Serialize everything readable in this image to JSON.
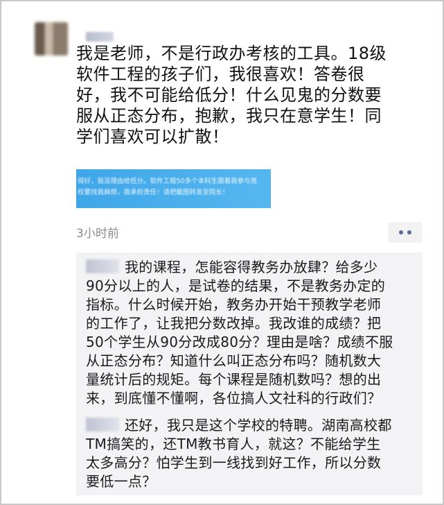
{
  "post": {
    "text_lines": [
      "我是老师，不是行政办考核的工具。18级",
      "软件工程的孩子们，我很喜欢！答卷很",
      "好，我不可能给低分！什么见鬼的分数要",
      "服从正态分布，抱歉，我只在意学生！同",
      "学们喜欢可以扩散！"
    ],
    "image_text_lines": [
      "得好，我没理由给低分。软件工程50多个本科生跟着我参与竞",
      "校要找我麻烦，我承担责任！请把截图转发至院长！"
    ],
    "time": "3小时前",
    "more_icon": "more-dots-icon"
  },
  "comments": [
    {
      "text_lines": [
        "我的课程，怎能容得教务办放肆？给多少",
        "90分以上的人，是试卷的结果，不是教务办定的",
        "指标。什么时候开始，教务办开始干预教学老师",
        "的工作了，让我把分数改掉。我改谁的成绩？把",
        "50个学生从90分改成80分？理由是啥？成绩不服",
        "从正态分布？知道什么叫正态分布吗？随机数大",
        "量统计后的规矩。每个课程是随机数吗？想的出",
        "来，到底懂不懂啊，各位搞人文社科的行政们？"
      ]
    },
    {
      "text_lines": [
        "还好，我只是这个学校的特聘。湖南高校都",
        "TM搞笑的，还TM教书育人，就这？不能给学生",
        "太多高分？怕学生到一线找到好工作，所以分数",
        "要低一点？"
      ]
    }
  ]
}
